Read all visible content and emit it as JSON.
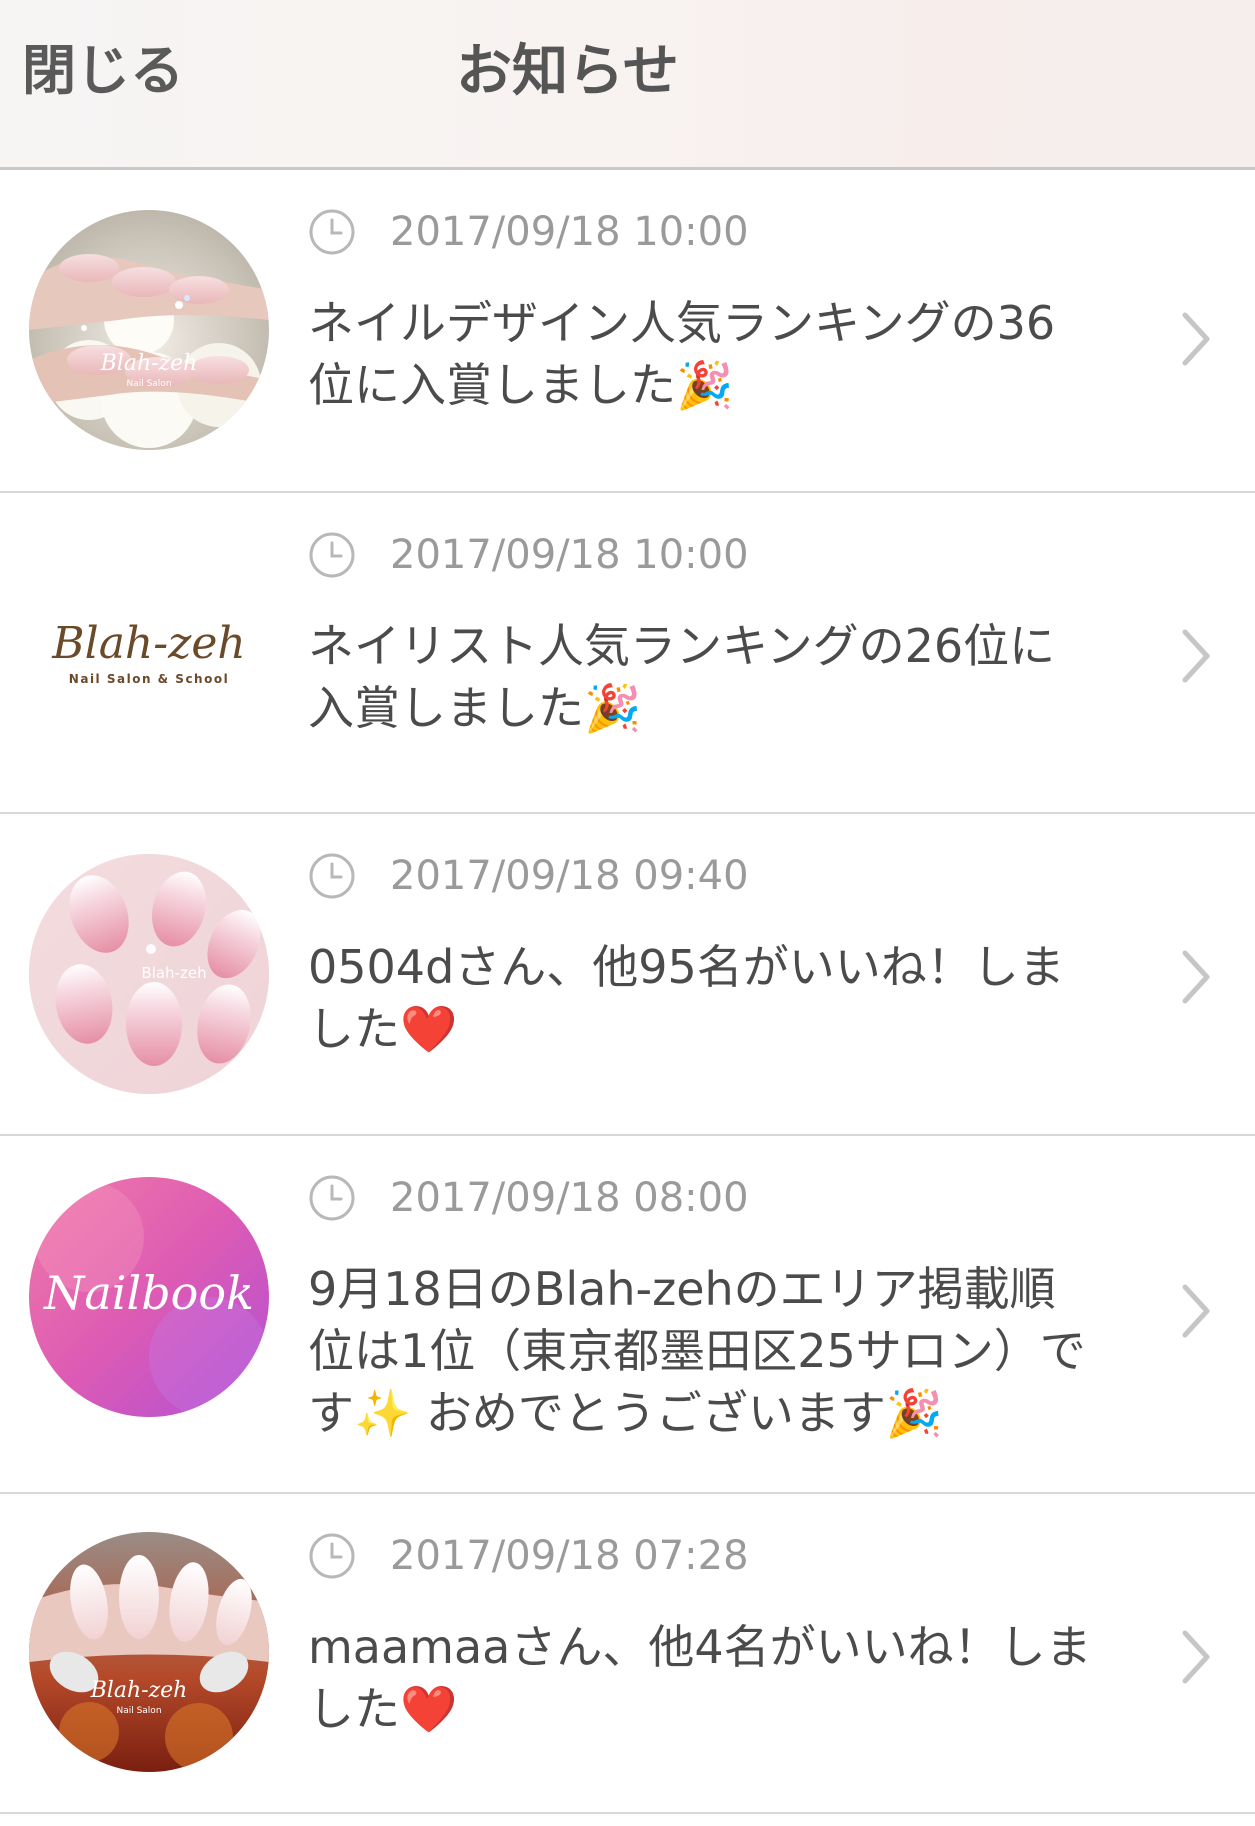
{
  "navbar": {
    "close_label": "閉じる",
    "title": "お知らせ"
  },
  "notifications": [
    {
      "timestamp": "2017/09/18 10:00",
      "message": "ネイルデザイン人気ランキングの36\n位に入賞しました🎉",
      "avatar_text": "Blah-zeh",
      "avatar_subtext": "Nail Salon"
    },
    {
      "timestamp": "2017/09/18 10:00",
      "message": "ネイリスト人気ランキングの26位に\n入賞しました🎉",
      "avatar_text": "Blah-zeh",
      "avatar_subtext": "Nail Salon & School"
    },
    {
      "timestamp": "2017/09/18 09:40",
      "message": "0504dさん、他95名がいいね！しま\nした❤️",
      "avatar_text": "Blah-zeh"
    },
    {
      "timestamp": "2017/09/18 08:00",
      "message": "9月18日のBlah-zehのエリア掲載順\n位は1位（東京都墨田区25サロン）で\nす✨ おめでとうございます🎉",
      "avatar_text": "Nailbook"
    },
    {
      "timestamp": "2017/09/18 07:28",
      "message": "maamaaさん、他4名がいいね！しま\nした❤️",
      "avatar_text": "Blah-zeh",
      "avatar_subtext": "Nail Salon"
    }
  ],
  "icons": {
    "timestamp_icon": "clock-icon",
    "row_arrow": "chevron-right-icon"
  },
  "colors": {
    "nailbook_pink": "#e9489b",
    "nailbook_purple": "#b04fd6",
    "brand_brown": "#6b4a2a"
  }
}
